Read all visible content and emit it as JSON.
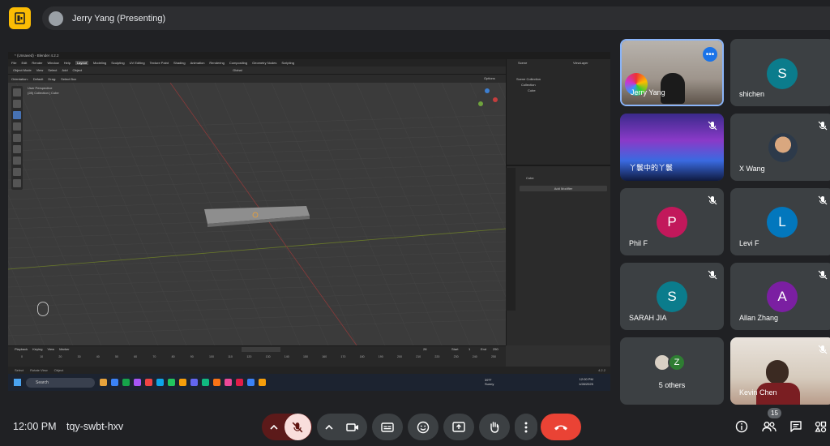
{
  "app": {
    "brand_color": "#fbbc04"
  },
  "header": {
    "presenter_label": "Jerry Yang (Presenting)"
  },
  "shared_screen": {
    "window_title": "* (Unsaved) - Blender 4.2.2",
    "menu_items": [
      "File",
      "Edit",
      "Render",
      "Window",
      "Help"
    ],
    "workspace_tabs": [
      "Layout",
      "Modeling",
      "Sculpting",
      "UV Editing",
      "Texture Paint",
      "Shading",
      "Animation",
      "Rendering",
      "Compositing",
      "Geometry Nodes",
      "Scripting"
    ],
    "active_workspace": "Layout",
    "header_items": [
      "Object Mode",
      "View",
      "Select",
      "Add",
      "Object"
    ],
    "transform_orientation": "Global",
    "header2_items": [
      "Orientation:",
      "Default",
      "Drag:",
      "Select Box"
    ],
    "options_label": "Options",
    "viewport_info_1": "User Perspective",
    "viewport_info_2": "(28) Collection | Cube",
    "scene_label": "Scene",
    "view_layer_label": "ViewLayer",
    "outliner": [
      "Scene Collection",
      "Collection",
      "Cube"
    ],
    "properties_object": "Cube",
    "add_modifier": "Add Modifier",
    "timeline_menu": [
      "Playback",
      "Keying",
      "View",
      "Marker"
    ],
    "current_frame": "28",
    "start_label": "Start",
    "start_value": "1",
    "end_label": "End",
    "end_value": "250",
    "ruler": [
      "0",
      "10",
      "20",
      "30",
      "40",
      "50",
      "60",
      "70",
      "80",
      "90",
      "100",
      "110",
      "120",
      "130",
      "140",
      "150",
      "160",
      "170",
      "180",
      "190",
      "200",
      "210",
      "220",
      "230",
      "240",
      "250"
    ],
    "status_items": [
      "Select",
      "Rotate View",
      "Object"
    ],
    "version": "4.2.2",
    "taskbar_search": "Search",
    "weather_temp": "39°F",
    "weather_text": "Sunny",
    "taskbar_time": "12:00 PM",
    "taskbar_date": "1/28/2025"
  },
  "participants": [
    {
      "name": "Jerry Yang",
      "type": "video"
    },
    {
      "name": "shichen",
      "initial": "S",
      "color": "#0b7c8c"
    },
    {
      "name": "丫鬟中的丫鬟",
      "type": "image"
    },
    {
      "name": "X Wang",
      "type": "avatar"
    },
    {
      "name": "Phil F",
      "initial": "P",
      "color": "#c2185b"
    },
    {
      "name": "Levi F",
      "initial": "L",
      "color": "#0277bd"
    },
    {
      "name": "SARAH JIA",
      "initial": "S",
      "color": "#0b7c8c"
    },
    {
      "name": "Allan Zhang",
      "initial": "A",
      "color": "#7b1fa2"
    },
    {
      "name": "5 others",
      "initial": "Z",
      "color": "#2e7d32"
    },
    {
      "name": "Kevin Chen",
      "type": "video"
    }
  ],
  "footer": {
    "time": "12:00 PM",
    "meeting_code": "tqy-swbt-hxv",
    "people_count": "15",
    "end_call_color": "#ea4335"
  }
}
